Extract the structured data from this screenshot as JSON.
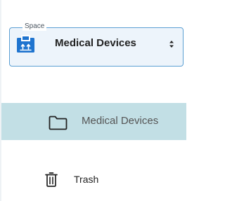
{
  "space_selector": {
    "legend": "Space",
    "selected_space": "Medical Devices",
    "icon": "space-box-icon",
    "arrows_icon": "up-down-chevron-icon",
    "accent_color": "#1f74cf"
  },
  "navigation": {
    "items": [
      {
        "label": "Medical Devices",
        "icon": "folder-icon",
        "active": true
      },
      {
        "label": "Trash",
        "icon": "trash-icon",
        "active": false
      }
    ]
  }
}
